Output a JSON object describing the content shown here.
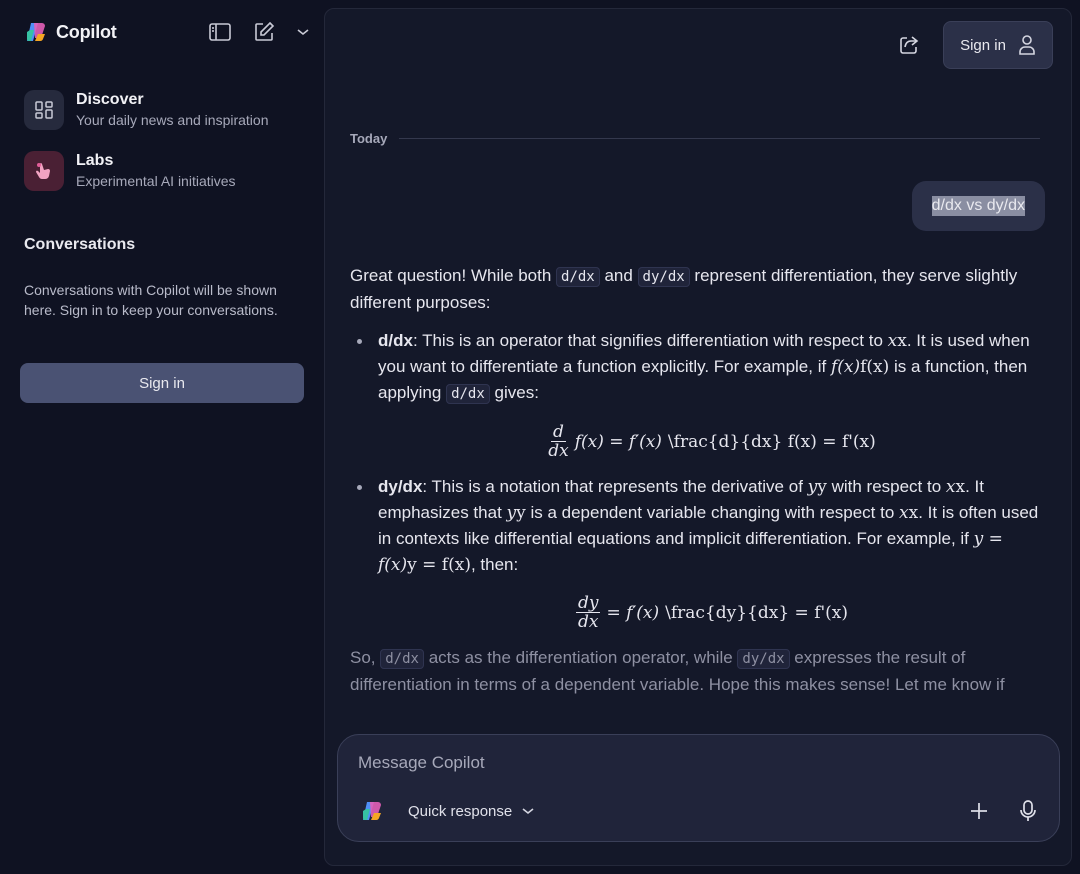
{
  "app": {
    "name": "Copilot"
  },
  "sidebar": {
    "items": [
      {
        "title": "Discover",
        "subtitle": "Your daily news and inspiration"
      },
      {
        "title": "Labs",
        "subtitle": "Experimental AI initiatives"
      }
    ],
    "conversations_title": "Conversations",
    "conversations_text": "Conversations with Copilot will be shown here. Sign in to keep your conversations.",
    "signin_label": "Sign in"
  },
  "header": {
    "signin_label": "Sign in"
  },
  "chat": {
    "day_label": "Today",
    "user_message": "d/dx vs dy/dx",
    "answer": {
      "intro_a": "Great question! While both ",
      "intro_code1": "d/dx",
      "intro_b": " and ",
      "intro_code2": "dy/dx",
      "intro_c": " represent differentiation, they serve slightly different purposes:",
      "b1_term": "d/dx",
      "b1_a": ": This is an operator that signifies differentiation with respect to ",
      "b1_xmath": "x",
      "b1_xraw": "x",
      "b1_b": ". It is used when you want to differentiate a function explicitly. For example, if ",
      "b1_fmath": "f(x)",
      "b1_fraw": "f(x)",
      "b1_c": " is a function, then applying ",
      "b1_code": "d/dx",
      "b1_d": " gives:",
      "eq1_num": "d",
      "eq1_den": "dx",
      "eq1_rhs": "f(x) = f′(x)",
      "eq1_raw": "\\frac{d}{dx} f(x) = f'(x)",
      "b2_term": "dy/dx",
      "b2_a": ": This is a notation that represents the derivative of ",
      "b2_ymath": "y",
      "b2_yraw": "y",
      "b2_b": " with respect to ",
      "b2_xmath": "x",
      "b2_xraw": "x",
      "b2_c": ". It emphasizes that ",
      "b2_ymath2": "y",
      "b2_yraw2": "y",
      "b2_d": " is a dependent variable changing with respect to ",
      "b2_xmath2": "x",
      "b2_xraw2": "x",
      "b2_e": ". It is often used in contexts like differential equations and implicit differentiation. For example, if ",
      "b2_eqmath": "y = f(x)",
      "b2_eqraw": "y = f(x)",
      "b2_f": ", then:",
      "eq2_num": "dy",
      "eq2_den": "dx",
      "eq2_rhs": "= f′(x)",
      "eq2_raw": "\\frac{dy}{dx} = f'(x)",
      "outro_a": "So, ",
      "outro_code1": "d/dx",
      "outro_b": " acts as the differentiation operator, while ",
      "outro_code2": "dy/dx",
      "outro_c": " expresses the result of differentiation in terms of a dependent variable. Hope this makes sense! Let me know if"
    }
  },
  "composer": {
    "placeholder": "Message Copilot",
    "mode_label": "Quick response"
  }
}
